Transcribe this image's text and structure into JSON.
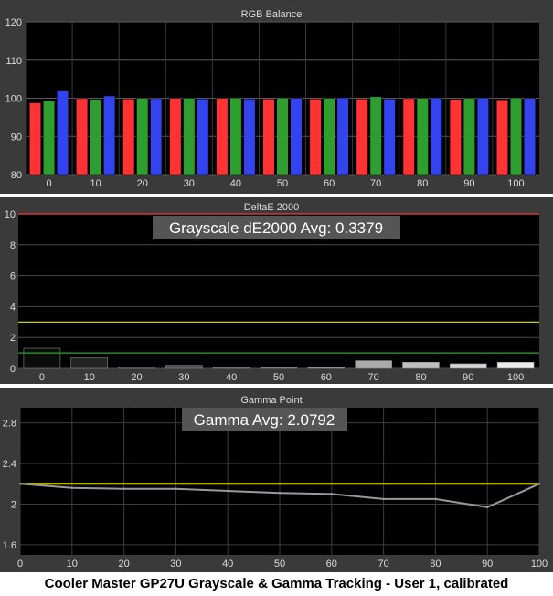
{
  "caption": "Cooler Master GP27U Grayscale & Gamma Tracking - User 1, calibrated",
  "colors": {
    "background": "#3a3a3a",
    "plot": "#000000",
    "axis_text": "#dddddd",
    "red": "#ff3333",
    "green": "#2e9e2e",
    "blue": "#3344ee",
    "yellow": "#e8e800",
    "limit_red": "#ff3a3a",
    "limit_green": "#22aa22",
    "gamma_line": "#9a9a9a"
  },
  "chart_data": [
    {
      "type": "bar",
      "title": "RGB Balance",
      "categories": [
        "0",
        "10",
        "20",
        "30",
        "40",
        "50",
        "60",
        "70",
        "80",
        "90",
        "100"
      ],
      "ylim": [
        80,
        120
      ],
      "yticks": [
        80,
        90,
        100,
        110,
        120
      ],
      "grid": true,
      "series": [
        {
          "values": [
            98.8,
            99.9,
            99.8,
            100.0,
            100.0,
            99.8,
            99.8,
            99.8,
            99.9,
            99.7,
            99.6
          ]
        },
        {
          "values": [
            99.4,
            99.7,
            100.0,
            100.0,
            100.1,
            100.1,
            100.0,
            100.4,
            100.0,
            100.0,
            100.1
          ]
        },
        {
          "values": [
            101.9,
            100.6,
            99.9,
            99.8,
            99.8,
            100.0,
            100.1,
            99.8,
            100.1,
            100.1,
            100.0
          ]
        }
      ]
    },
    {
      "type": "bar",
      "title": "DeltaE 2000",
      "annotation": "Grayscale dE2000 Avg: 0.3379",
      "categories": [
        "0",
        "10",
        "20",
        "30",
        "40",
        "50",
        "60",
        "70",
        "80",
        "90",
        "100"
      ],
      "ylim": [
        0,
        10
      ],
      "yticks": [
        0,
        2,
        4,
        6,
        8,
        10
      ],
      "grid": true,
      "values": [
        1.3,
        0.7,
        0.1,
        0.2,
        0.1,
        0.1,
        0.1,
        0.5,
        0.4,
        0.3,
        0.4
      ],
      "reference_lines": [
        {
          "y": 10,
          "color": "#ff3a3a"
        },
        {
          "y": 3,
          "color": "#e8e800"
        },
        {
          "y": 1,
          "color": "#22aa22"
        }
      ]
    },
    {
      "type": "line",
      "title": "Gamma Point",
      "annotation": "Gamma Avg: 2.0792",
      "x": [
        0,
        10,
        20,
        30,
        40,
        50,
        60,
        70,
        80,
        90,
        100
      ],
      "values": [
        2.2,
        2.16,
        2.15,
        2.15,
        2.13,
        2.11,
        2.1,
        2.05,
        2.05,
        1.97,
        2.2
      ],
      "xlim": [
        0,
        100
      ],
      "ylim": [
        1.5,
        2.95
      ],
      "yticks": [
        1.6,
        2,
        2.4,
        2.8
      ],
      "yticklabels": [
        "1.6",
        "2",
        "2.4",
        "2.8"
      ],
      "xticks": [
        0,
        10,
        20,
        30,
        40,
        50,
        60,
        70,
        80,
        90,
        100
      ],
      "grid": true,
      "reference_lines": [
        {
          "y": 2.2,
          "color": "#e8e800"
        }
      ]
    }
  ]
}
